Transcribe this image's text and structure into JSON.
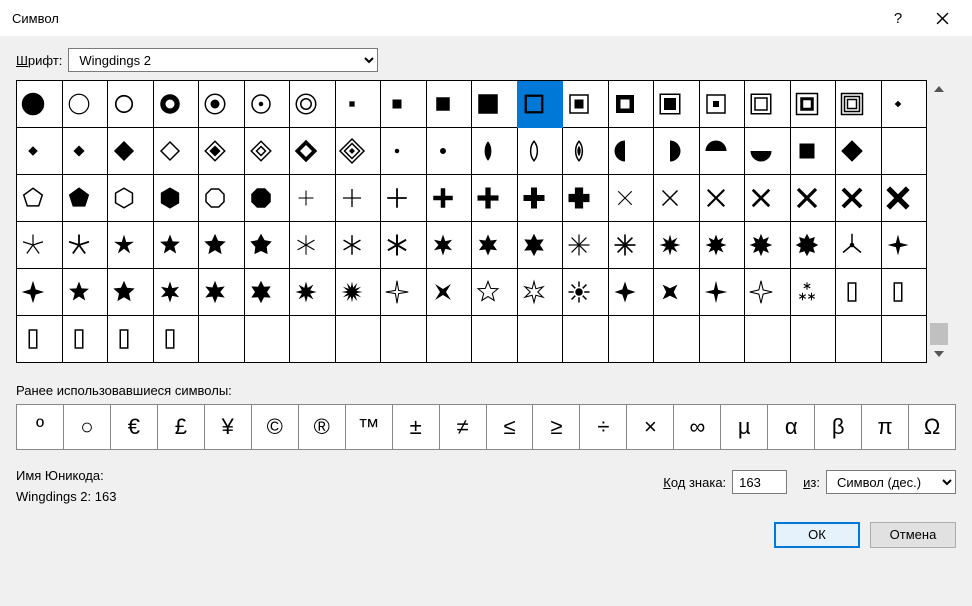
{
  "title": "Символ",
  "help_icon": "?",
  "font_label_pre": "Ш",
  "font_label_rest": "рифт:",
  "font_value": "Wingdings 2",
  "grid": {
    "rows": 6,
    "cols": 20,
    "selected": {
      "row": 0,
      "col": 11
    },
    "cells": [
      [
        "●",
        "○",
        "○",
        "◉",
        "◉",
        "⊙",
        "◎",
        "·",
        "▪",
        "■",
        "■",
        "□",
        "⊡",
        "◘",
        "▣",
        "⊡",
        "▣",
        "▣",
        "▣",
        "·"
      ],
      [
        "⬩",
        "⬩",
        "◆",
        "◇",
        "◈",
        "◈",
        "◈",
        "◈",
        "·",
        "·",
        "◆",
        "◇",
        "◈",
        "◖",
        "◗",
        "◓",
        "◡",
        "■",
        "◆",
        ""
      ],
      [
        "⬠",
        "⬟",
        "⬡",
        "⬢",
        "⯃",
        "⯂",
        "+",
        "+",
        "+",
        "✚",
        "✚",
        "✚",
        "✚",
        "×",
        "✕",
        "✕",
        "✕",
        "✖",
        "✖",
        "✖"
      ],
      [
        "⚹",
        "✱",
        "✱",
        "✱",
        "✱",
        "✱",
        "✲",
        "✳",
        "✳",
        "✳",
        "✳",
        "✳",
        "✳",
        "✳",
        "✳",
        "✳",
        "✳",
        "✳",
        "⅄",
        "✦"
      ],
      [
        "✦",
        "★",
        "★",
        "★",
        "✶",
        "✷",
        "❋",
        "✺",
        "✣",
        "✦",
        "✧",
        "✯",
        "❂",
        "✦",
        "✦",
        "✦",
        "✧",
        "⁂",
        "▯",
        "▯"
      ],
      [
        "▯",
        "▯",
        "▯",
        "▯",
        "",
        "",
        "",
        "",
        "",
        "",
        "",
        "",
        "",
        "",
        "",
        "",
        "",
        "",
        "",
        ""
      ]
    ]
  },
  "recent_label": "Ранее использовавшиеся символы:",
  "recent": [
    "º",
    "○",
    "€",
    "£",
    "¥",
    "©",
    "®",
    "™",
    "±",
    "≠",
    "≤",
    "≥",
    "÷",
    "×",
    "∞",
    "µ",
    "α",
    "β",
    "π",
    "Ω"
  ],
  "unicode_label": "Имя Юникода:",
  "unicode_value": "Wingdings 2: 163",
  "code_label_pre": "К",
  "code_label_rest": "од знака:",
  "code_value": "163",
  "from_label_pre": "и",
  "from_label_rest": "з:",
  "from_value": "Символ (дес.)",
  "ok_label": "ОК",
  "cancel_label": "Отмена"
}
